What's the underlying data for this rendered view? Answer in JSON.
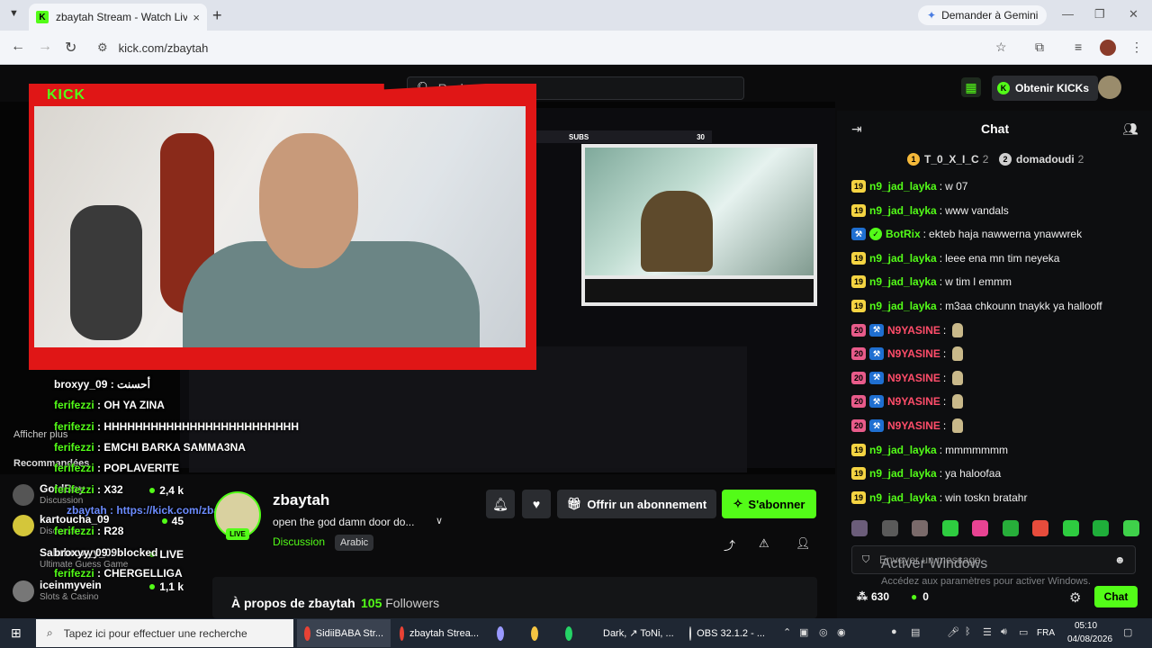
{
  "browser": {
    "tab_title": "zbaytah Stream - Watch Live o",
    "tab_close": "×",
    "new_tab": "+",
    "gemini_label": "Demander à Gemini",
    "url": "kick.com/zbaytah"
  },
  "topnav": {
    "logo": "KICK",
    "search_placeholder": "Rechercher",
    "get_kicks": "Obtenir KICKs"
  },
  "stream_overlay": {
    "subs_label": "SUBS",
    "subs_count": "30"
  },
  "stream_chat": [
    {
      "user": "broxyy_09",
      "msg": " : أحسنت",
      "color": "#ffffff"
    },
    {
      "user": "ferifezzi",
      "msg": " : OH YA ZINA",
      "color": "#53fc18"
    },
    {
      "user": "ferifezzi",
      "msg": " : HHHHHHHHHHHHHHHHHHHHHHHHH",
      "color": "#53fc18"
    },
    {
      "user": "ferifezzi",
      "msg": " : EMCHI BARKA SAMMA3NA",
      "color": "#53fc18"
    },
    {
      "user": "ferifezzi",
      "msg": " : POPLAVERITE",
      "color": "#53fc18"
    },
    {
      "user": "ferifezzi",
      "msg": " : X32",
      "color": "#53fc18"
    },
    {
      "user": "zbaytah",
      "msg": " : https://kick.com/zbaytah",
      "color": "#6c8cff"
    },
    {
      "user": "ferifezzi",
      "msg": " : R28",
      "color": "#53fc18"
    },
    {
      "user": "broxyy_09",
      "msg": " : blocked",
      "color": "#ffffff"
    },
    {
      "user": "ferifezzi",
      "msg": " : CHERGELLIGA",
      "color": "#53fc18"
    }
  ],
  "sidebar": {
    "show_more": "Afficher plus",
    "recommended": "Recommandées",
    "items": [
      {
        "name": "GoldBoy",
        "category": "Discussion",
        "viewers": "2,4 k",
        "live": false
      },
      {
        "name": "kartoucha_09",
        "category": "Discussion",
        "viewers": "45",
        "live": false
      },
      {
        "name": "Sabrbroxyy_09",
        "category": "Ultimate Guess Game",
        "viewers": "LIVE",
        "live": true
      },
      {
        "name": "iceinmyvein",
        "category": "Slots & Casino",
        "viewers": "1,1 k",
        "live": false
      }
    ]
  },
  "stream_info": {
    "streamer": "zbaytah",
    "live_badge": "LIVE",
    "title": "open the god damn door do...",
    "category": "Discussion",
    "language": "Arabic",
    "gift_sub": "Offrir un abonnement",
    "subscribe": "S'abonner",
    "about": "À propos de zbaytah",
    "followers_count": "105",
    "followers_label": "Followers"
  },
  "chat": {
    "title": "Chat",
    "gifters": [
      {
        "name": "T_0_X_I_C",
        "count": "2",
        "badge": "1",
        "color": "#f5b93a"
      },
      {
        "name": "domadoudi",
        "count": "2",
        "badge": "2",
        "color": "#cfcfcf"
      }
    ],
    "messages": [
      {
        "badge": "19",
        "badge_color": "#f5d442",
        "user": "n9_jad_layka",
        "user_color": "#53fc18",
        "text": "w 07"
      },
      {
        "badge": "19",
        "badge_color": "#f5d442",
        "user": "n9_jad_layka",
        "user_color": "#53fc18",
        "text": "www vandals"
      },
      {
        "badge": "bot",
        "badge_color": "#53fc18",
        "user": "BotRix",
        "user_color": "#53fc18",
        "text": "ekteb haja nawwerna ynawwrek"
      },
      {
        "badge": "19",
        "badge_color": "#f5d442",
        "user": "n9_jad_layka",
        "user_color": "#53fc18",
        "text": "leee ena mn tim neyeka"
      },
      {
        "badge": "19",
        "badge_color": "#f5d442",
        "user": "n9_jad_layka",
        "user_color": "#53fc18",
        "text": "w tim l emmm"
      },
      {
        "badge": "19",
        "badge_color": "#f5d442",
        "user": "n9_jad_layka",
        "user_color": "#53fc18",
        "text": "m3aa chkounn tnaykk ya hallooff"
      },
      {
        "badge": "20",
        "badge_color": "#e85b8a",
        "user": "N9YASINE",
        "user_color": "#ff4d6a",
        "text": "",
        "emote": true
      },
      {
        "badge": "20",
        "badge_color": "#e85b8a",
        "user": "N9YASINE",
        "user_color": "#ff4d6a",
        "text": "",
        "emote": true
      },
      {
        "badge": "20",
        "badge_color": "#e85b8a",
        "user": "N9YASINE",
        "user_color": "#ff4d6a",
        "text": "",
        "emote": true
      },
      {
        "badge": "20",
        "badge_color": "#e85b8a",
        "user": "N9YASINE",
        "user_color": "#ff4d6a",
        "text": "",
        "emote": true
      },
      {
        "badge": "20",
        "badge_color": "#e85b8a",
        "user": "N9YASINE",
        "user_color": "#ff4d6a",
        "text": "",
        "emote": true
      },
      {
        "badge": "19",
        "badge_color": "#f5d442",
        "user": "n9_jad_layka",
        "user_color": "#53fc18",
        "text": "mmmmmmm"
      },
      {
        "badge": "19",
        "badge_color": "#f5d442",
        "user": "n9_jad_layka",
        "user_color": "#53fc18",
        "text": "ya haloofaa"
      },
      {
        "badge": "19",
        "badge_color": "#f5d442",
        "user": "n9_jad_layka",
        "user_color": "#53fc18",
        "text": "win toskn bratahr"
      }
    ],
    "input_placeholder": "Envoyer un message",
    "points": "630",
    "kicks": "0",
    "send": "Chat",
    "windows_activate": "Activer Windows",
    "windows_activate_sub": "Accédez aux paramètres pour activer Windows."
  },
  "taskbar": {
    "search_placeholder": "Tapez ici pour effectuer une recherche",
    "apps": [
      {
        "label": "SidiiBABA Str...",
        "color": "#e94235",
        "active": true
      },
      {
        "label": "zbaytah Strea...",
        "color": "#e94235",
        "active": false
      },
      {
        "label": "",
        "color": "#9999ff",
        "active": false
      },
      {
        "label": "",
        "color": "#f5c542",
        "active": false
      },
      {
        "label": "",
        "color": "#25d366",
        "active": false
      },
      {
        "label": "Dark, ↗ ToNi, ...",
        "color": "#5865f2",
        "active": false
      },
      {
        "label": "OBS 32.1.2 - ...",
        "color": "#dddddd",
        "active": false
      }
    ],
    "language": "FRA",
    "time": "05:10",
    "date": "04/08/2026"
  }
}
